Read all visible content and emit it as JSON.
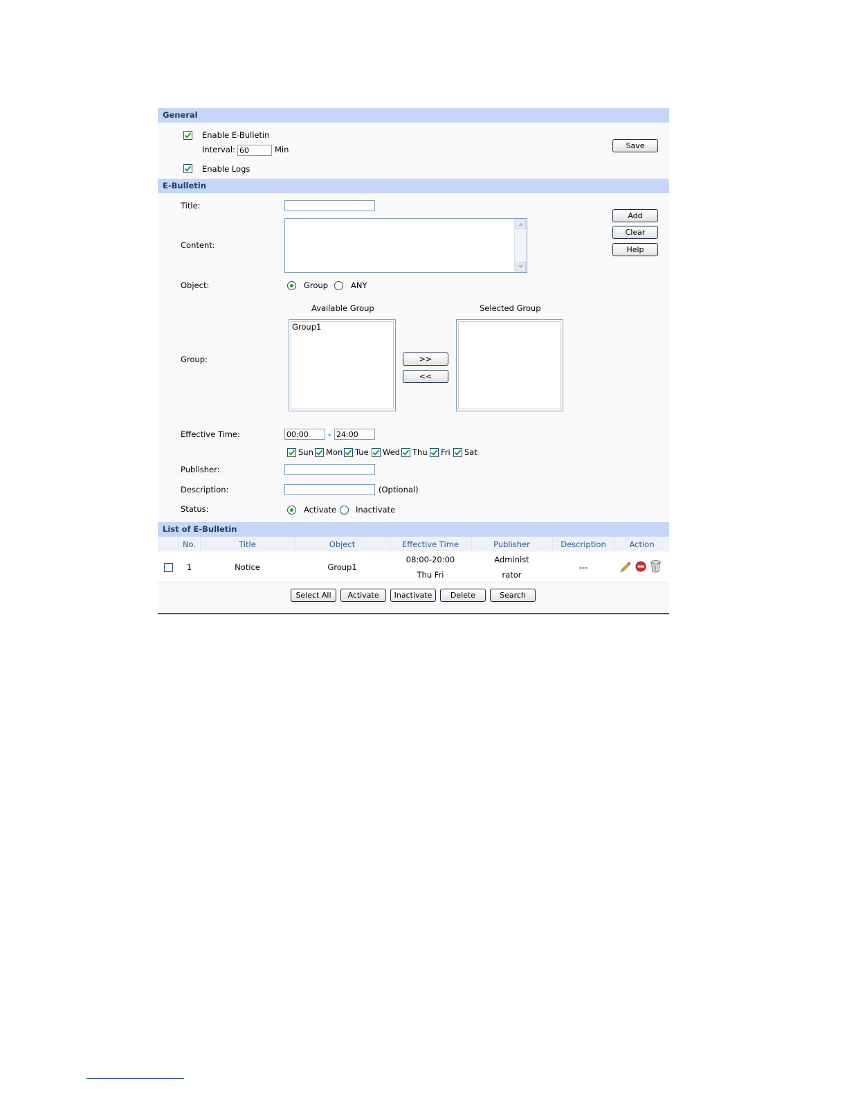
{
  "general": {
    "header": "General",
    "enable_bulletin_label": "Enable E-Bulletin",
    "interval_label": "Interval:",
    "interval_value": "60",
    "interval_unit": "Min",
    "enable_logs_label": "Enable Logs",
    "save_label": "Save"
  },
  "bulletin": {
    "header": "E-Bulletin",
    "title_label": "Title:",
    "title_value": "",
    "content_label": "Content:",
    "content_value": "",
    "object_label": "Object:",
    "object_options": [
      "Group",
      "ANY"
    ],
    "group_label": "Group:",
    "available_group_label": "Available Group",
    "selected_group_label": "Selected Group",
    "available_groups": [
      "Group1"
    ],
    "move_right_label": ">>",
    "move_left_label": "<<",
    "effective_time_label": "Effective Time:",
    "time_start": "00:00",
    "time_sep": "-",
    "time_end": "24:00",
    "days": [
      "Sun",
      "Mon",
      "Tue",
      "Wed",
      "Thu",
      "Fri",
      "Sat"
    ],
    "publisher_label": "Publisher:",
    "publisher_value": "",
    "description_label": "Description:",
    "description_value": "",
    "optional_note": "(Optional)",
    "status_label": "Status:",
    "status_options": [
      "Activate",
      "Inactivate"
    ],
    "add_label": "Add",
    "clear_label": "Clear",
    "help_label": "Help"
  },
  "list": {
    "header": "List of E-Bulletin",
    "columns": [
      "No.",
      "Title",
      "Object",
      "Effective Time",
      "Publisher",
      "Description",
      "Action"
    ],
    "rows": [
      {
        "no": "1",
        "title": "Notice",
        "object": "Group1",
        "time_line1": "08:00-20:00",
        "time_line2": "Thu Fri",
        "publisher_line1": "Administ",
        "publisher_line2": "rator",
        "description": "---",
        "actions": [
          "edit-icon",
          "disable-icon",
          "delete-icon"
        ]
      }
    ],
    "buttons": {
      "select_all": "Select All",
      "activate": "Activate",
      "inactivate": "Inactivate",
      "delete": "Delete",
      "search": "Search"
    }
  },
  "colors": {
    "section_header_bg": "#c6d6f9",
    "section_header_text": "#1b3b72",
    "column_header_text": "#2a5d9b",
    "check_mark": "#21a121"
  }
}
